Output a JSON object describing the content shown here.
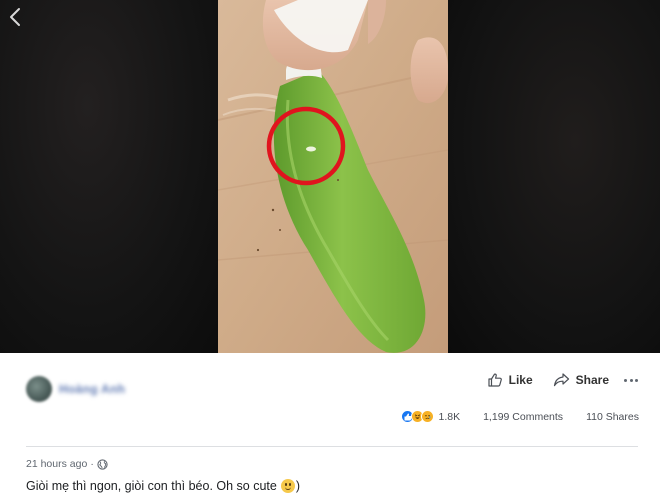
{
  "post": {
    "author_name": "Hoàng Anh",
    "timestamp": "21 hours ago",
    "separator": "·",
    "audience_icon": "globe-icon",
    "caption_text": "Giòi mẹ thì ngon, giòi con thì béo. Oh so cute",
    "caption_emoji": "smiling-face-emoji",
    "caption_suffix": ")"
  },
  "actions": {
    "like_label": "Like",
    "share_label": "Share",
    "like_icon": "thumbs-up-icon",
    "share_icon": "share-arrow-icon",
    "more_icon": "more-dots-icon"
  },
  "stats": {
    "reactions": [
      "like",
      "haha",
      "sad"
    ],
    "reaction_count": "1.8K",
    "comments": "1,199 Comments",
    "shares": "110 Shares"
  },
  "media": {
    "back_icon": "chevron-left-icon",
    "highlight_color": "#e0141e"
  }
}
